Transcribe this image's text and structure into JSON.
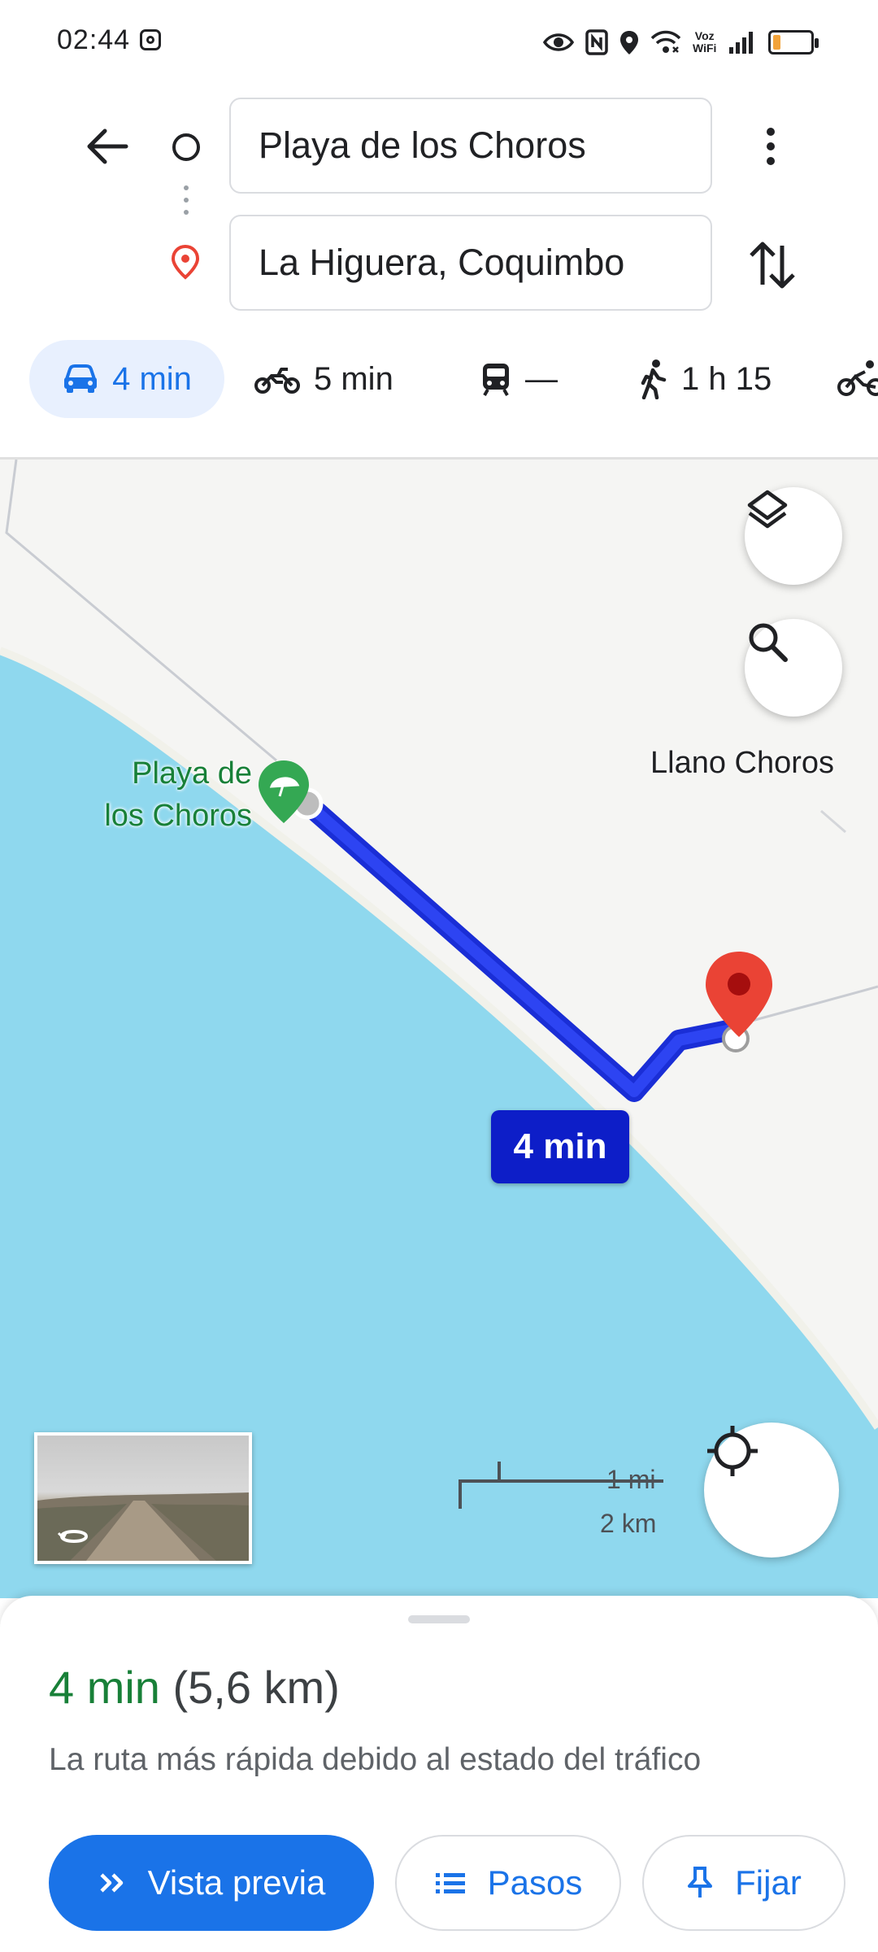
{
  "status_bar": {
    "time": "02:44",
    "voz_line1": "Voz",
    "voz_line2": "WiFi",
    "battery_level_percent": 20,
    "battery_color": "#f2a33a",
    "icons": [
      "instagram-icon",
      "eye-icon",
      "nfc-icon",
      "location-icon",
      "wifi-icon",
      "signal-icon",
      "battery-icon"
    ]
  },
  "header": {
    "origin": "Playa de los Choros",
    "destination": "La Higuera, Coquimbo"
  },
  "modes": [
    {
      "name": "car",
      "label": "4 min",
      "selected": true
    },
    {
      "name": "motorcycle",
      "label": "5 min"
    },
    {
      "name": "transit",
      "label": "—"
    },
    {
      "name": "walk",
      "label": "1 h 15"
    },
    {
      "name": "bike",
      "label": ""
    }
  ],
  "map": {
    "place_llano": "Llano Choros",
    "place_playa_line1": "Playa de",
    "place_playa_line2": "los Choros",
    "route_time": "4 min",
    "scale_mi": "1 mi",
    "scale_km": "2 km",
    "colors": {
      "water": "#8fd8ee",
      "land": "#f5f5f3",
      "route": "#0d1ec8",
      "route_outline": "#1a2ed6",
      "dest_pin": "#ea4335",
      "beach_pin": "#34a853"
    }
  },
  "sheet": {
    "time": "4 min",
    "distance": "(5,6 km)",
    "note": "La ruta más rápida debido al estado del tráfico",
    "preview_label": "Vista previa",
    "steps_label": "Pasos",
    "pin_label": "Fijar",
    "accent": "#1a73e8",
    "time_color": "#188038"
  }
}
